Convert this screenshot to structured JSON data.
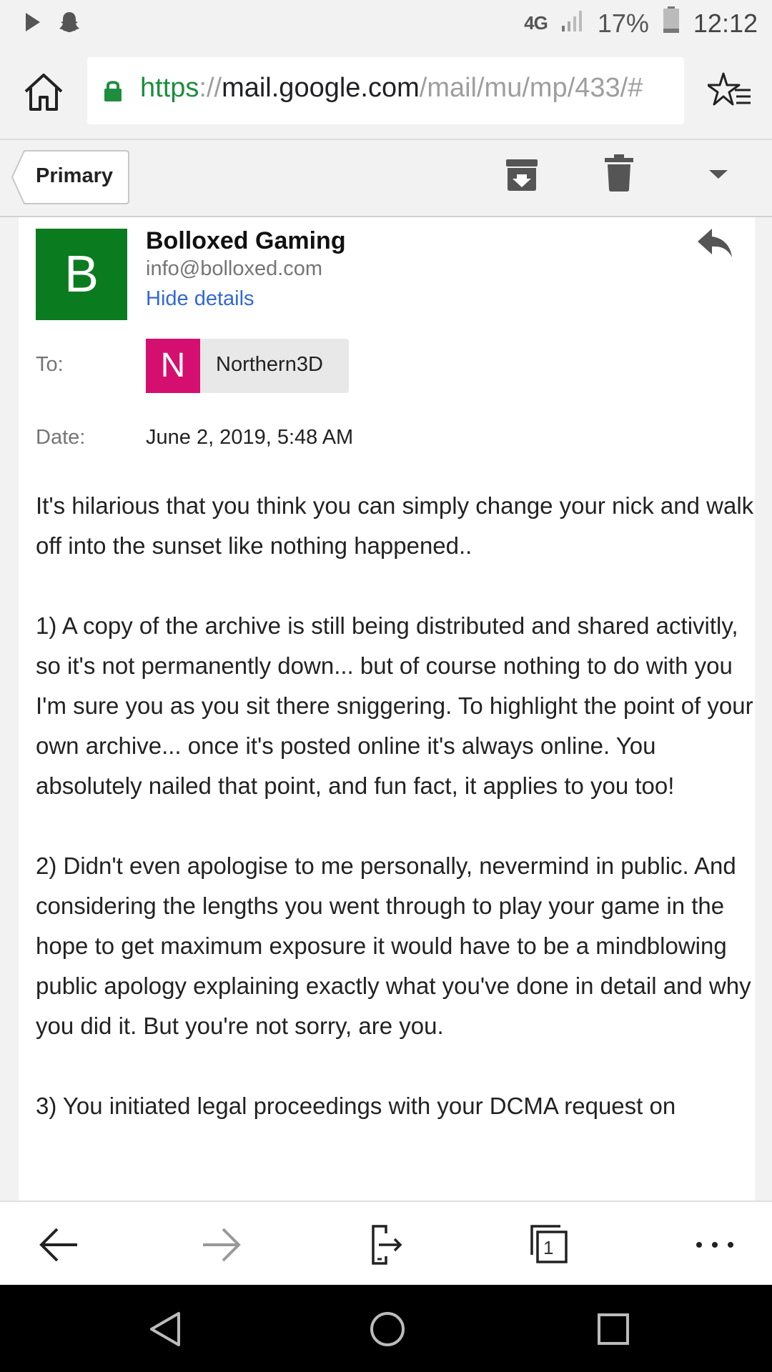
{
  "status_bar": {
    "network": "4G",
    "battery_percent": "17%",
    "time": "12:12",
    "icons": [
      "play-icon",
      "snapchat-icon",
      "signal-icon",
      "battery-icon"
    ]
  },
  "browser": {
    "url_scheme": "https",
    "url_separator": "://",
    "url_host": "mail.google.com",
    "url_path": "/mail/mu/mp/433/#",
    "icons": [
      "home-icon",
      "lock-icon",
      "favorites-icon"
    ]
  },
  "toolbar": {
    "back_label": "Primary",
    "icons": [
      "archive-icon",
      "delete-icon",
      "chevron-down-icon"
    ]
  },
  "email": {
    "sender_initial": "B",
    "sender_name": "Bolloxed Gaming",
    "sender_email": "info@bolloxed.com",
    "hide_details_label": "Hide details",
    "to_label": "To:",
    "recipient_initial": "N",
    "recipient_name": "Northern3D",
    "date_label": "Date:",
    "date_value": "June 2, 2019, 5:48 AM",
    "paragraphs": [
      "It's hilarious that you think you can simply change your nick and walk off into the sunset like nothing happened..",
      "1) A copy of the archive is still being distributed and shared activitly, so it's not permanently down... but of course nothing to do with you I'm sure you as you sit there sniggering. To highlight the point of your own archive... once it's posted online it's always online. You absolutely nailed that point, and fun fact, it applies to you too!",
      "2) Didn't even apologise to me personally, nevermind in public. And considering the lengths you went through to play your game in the hope to get maximum exposure it would have to be a mindblowing public apology explaining exactly what you've done in detail and why you did it. But you're not sorry, are you.",
      "3) You initiated legal proceedings with your DCMA request on"
    ]
  },
  "bottom_bar": {
    "tab_count": "1",
    "icons": [
      "back-arrow-icon",
      "forward-arrow-icon",
      "share-icon",
      "tabs-icon",
      "more-icon"
    ]
  },
  "nav_bar": {
    "icons": [
      "nav-back-icon",
      "nav-home-icon",
      "nav-recents-icon"
    ]
  },
  "colors": {
    "sender_avatar": "#0b7b1f",
    "recipient_avatar": "#d50f70",
    "link": "#3367d6",
    "secure_scheme": "#1e8e3e"
  }
}
